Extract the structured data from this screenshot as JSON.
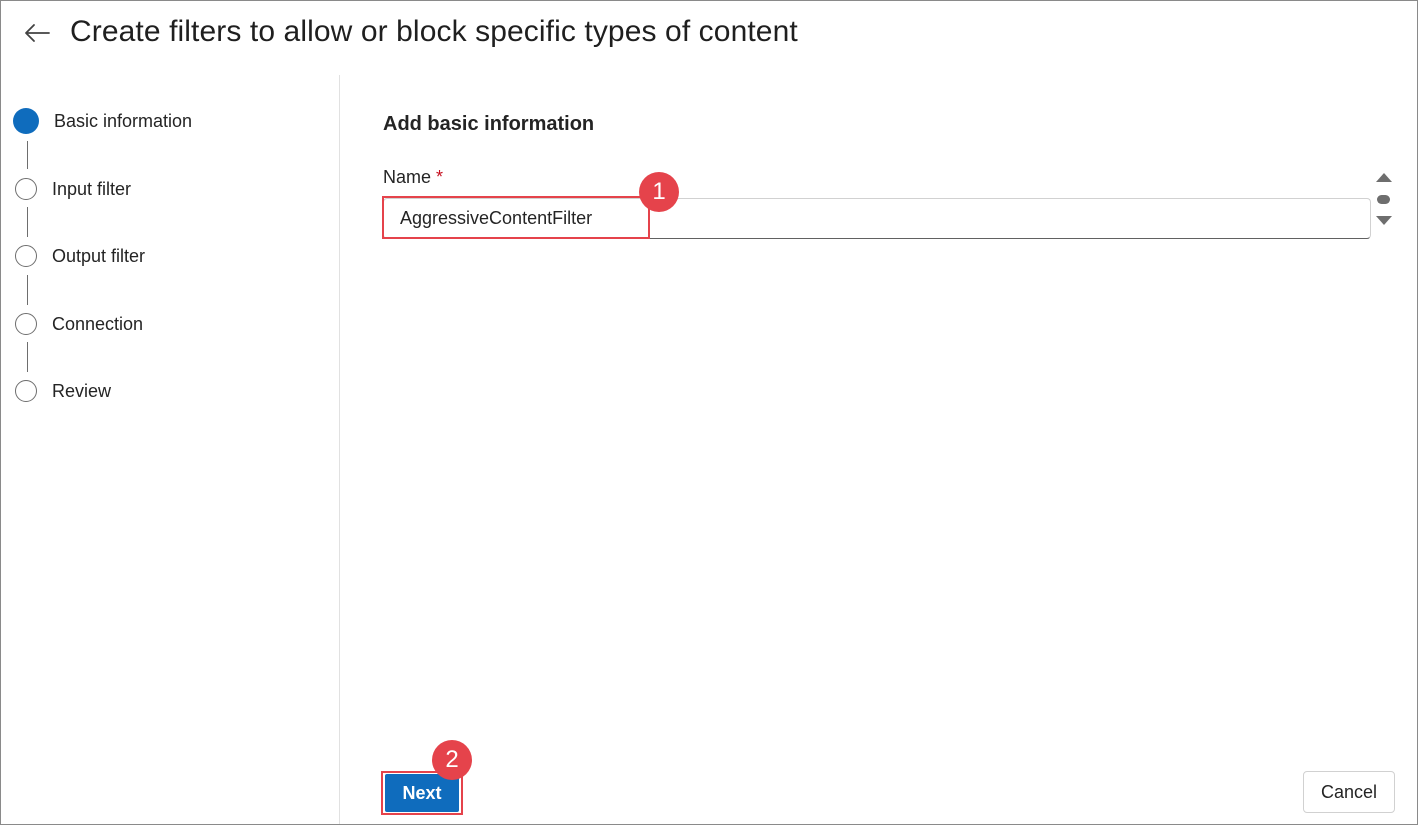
{
  "header": {
    "back_icon": "arrow-left-icon",
    "title": "Create filters to allow or block specific types of content"
  },
  "stepper": {
    "steps": [
      {
        "label": "Basic information",
        "state": "active"
      },
      {
        "label": "Input filter",
        "state": "pending"
      },
      {
        "label": "Output filter",
        "state": "pending"
      },
      {
        "label": "Connection",
        "state": "pending"
      },
      {
        "label": "Review",
        "state": "pending"
      }
    ]
  },
  "form": {
    "section_title": "Add basic information",
    "name_label": "Name",
    "required_marker": "*",
    "name_value": "AggressiveContentFilter"
  },
  "annotations": {
    "badge_1": "1",
    "badge_2": "2"
  },
  "footer": {
    "next_label": "Next",
    "cancel_label": "Cancel"
  },
  "colors": {
    "accent": "#0f6cbd",
    "annotation_red": "#e5434b",
    "required_red": "#c50f1f"
  }
}
